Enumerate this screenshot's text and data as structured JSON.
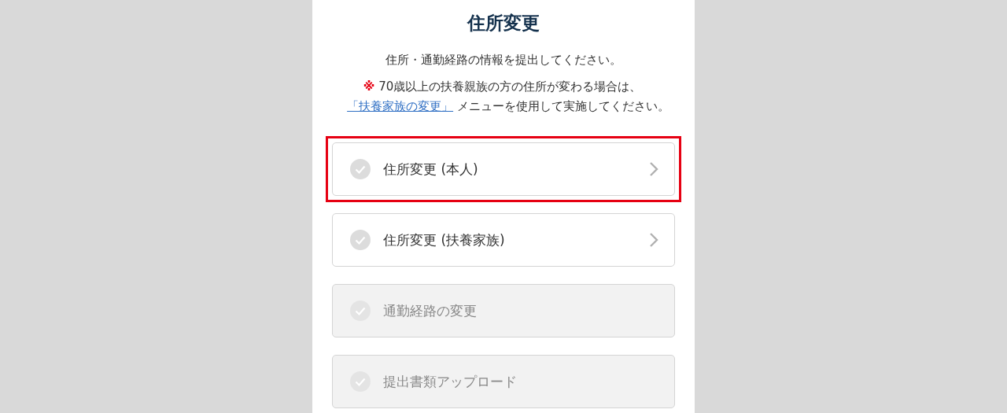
{
  "title": "住所変更",
  "subtitle": "住所・通勤経路の情報を提出してください。",
  "note": {
    "mark": "※",
    "text_before": "70歳以上の扶養親族の方の住所が変わる場合は、",
    "link": "「扶養家族の変更」",
    "text_after": "メニューを使用して実施してください。"
  },
  "menu_items": [
    {
      "label": "住所変更 (本人)",
      "disabled": false,
      "highlighted": true
    },
    {
      "label": "住所変更 (扶養家族)",
      "disabled": false,
      "highlighted": false
    },
    {
      "label": "通勤経路の変更",
      "disabled": true,
      "highlighted": false
    },
    {
      "label": "提出書類アップロード",
      "disabled": true,
      "highlighted": false
    }
  ]
}
